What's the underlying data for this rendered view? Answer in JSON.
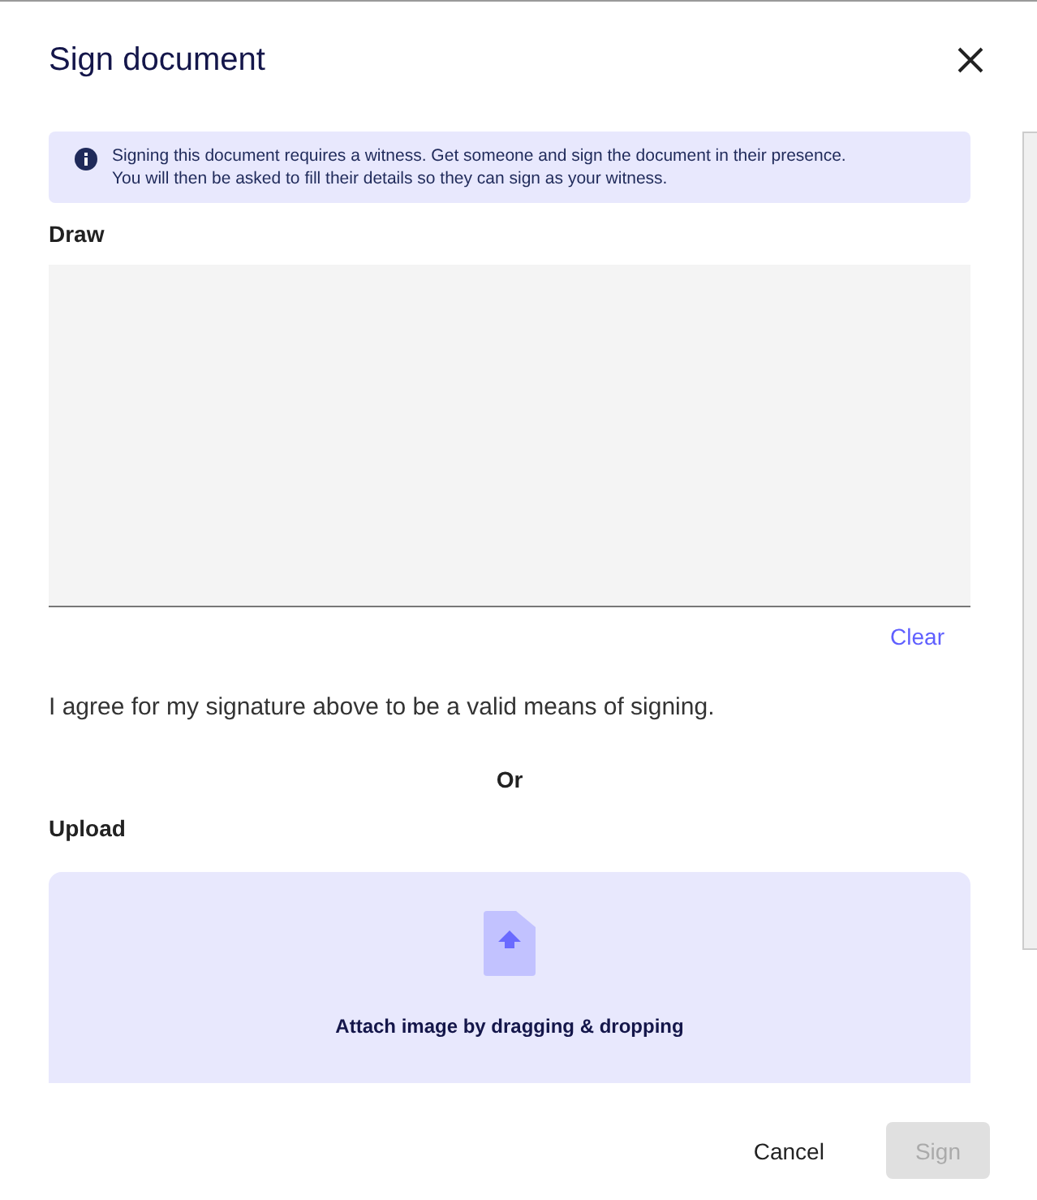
{
  "dialog": {
    "title": "Sign document"
  },
  "notice": {
    "lines": [
      "Signing this document requires a witness. Get someone and sign the document in their presence.",
      "You will then be asked to fill their details so they can sign as your witness."
    ]
  },
  "draw": {
    "label": "Draw",
    "clear": "Clear"
  },
  "agreement": "I agree for my signature above to be a valid means of signing.",
  "separator": "Or",
  "upload": {
    "label": "Upload",
    "hint": "Attach image by dragging & dropping"
  },
  "buttons": [
    {
      "label": "Cancel",
      "kind": "text",
      "disabled": false
    },
    {
      "label": "Sign",
      "kind": "primary",
      "disabled": true
    }
  ]
}
